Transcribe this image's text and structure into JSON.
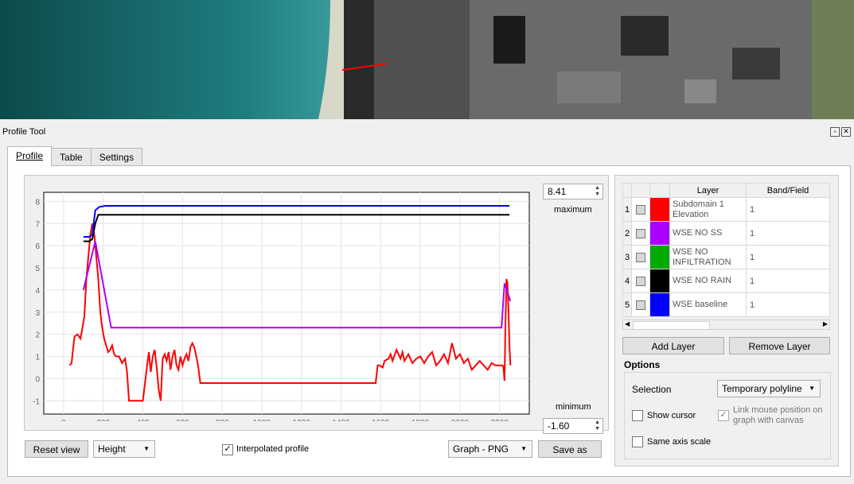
{
  "panel": {
    "title": "Profile Tool"
  },
  "tabs": [
    {
      "label": "Profile",
      "active": true
    },
    {
      "label": "Table",
      "active": false
    },
    {
      "label": "Settings",
      "active": false
    }
  ],
  "scale": {
    "maximum_value": "8.41",
    "maximum_label": "maximum",
    "minimum_value": "-1.60",
    "minimum_label": "minimum"
  },
  "bottom_bar": {
    "reset_view": "Reset view",
    "height_combo": "Height",
    "interpolated_label": "Interpolated profile",
    "interpolated_checked": true,
    "export_combo": "Graph - PNG",
    "save_as": "Save as"
  },
  "layers_table": {
    "headers": [
      "Layer",
      "Band/Field"
    ],
    "rows": [
      {
        "num": "1",
        "color": "#ff0000",
        "layer": "Subdomain 1 Elevation",
        "band": "1"
      },
      {
        "num": "2",
        "color": "#aa00ff",
        "layer": "WSE NO SS",
        "band": "1"
      },
      {
        "num": "3",
        "color": "#00aa00",
        "layer": "WSE NO INFILTRATION",
        "band": "1"
      },
      {
        "num": "4",
        "color": "#000000",
        "layer": "WSE NO RAIN",
        "band": "1"
      },
      {
        "num": "5",
        "color": "#0000ff",
        "layer": "WSE baseline",
        "band": "1"
      }
    ]
  },
  "layer_buttons": {
    "add": "Add Layer",
    "remove": "Remove Layer"
  },
  "options": {
    "title": "Options",
    "selection_label": "Selection",
    "selection_value": "Temporary polyline",
    "show_cursor": "Show cursor",
    "link_mouse": "Link mouse position on graph with canvas",
    "same_axis": "Same axis scale"
  },
  "chart_data": {
    "type": "line",
    "xlim": [
      -100,
      2350
    ],
    "ylim": [
      -1.6,
      8.41
    ],
    "x_ticks": [
      0,
      200,
      400,
      600,
      800,
      1000,
      1200,
      1400,
      1600,
      1800,
      2000,
      2200
    ],
    "y_ticks": [
      -1,
      0,
      1,
      2,
      3,
      4,
      5,
      6,
      7,
      8
    ],
    "grid": true,
    "series": [
      {
        "name": "Subdomain 1 Elevation",
        "color": "#ff0000",
        "x": [
          30,
          40,
          55,
          70,
          85,
          95,
          105,
          115,
          125,
          135,
          145,
          155,
          165,
          175,
          185,
          195,
          205,
          215,
          225,
          235,
          245,
          255,
          265,
          280,
          295,
          310,
          320,
          330,
          345,
          360,
          400,
          420,
          430,
          440,
          450,
          460,
          470,
          480,
          490,
          500,
          510,
          520,
          530,
          540,
          550,
          560,
          570,
          580,
          590,
          600,
          610,
          620,
          630,
          640,
          650,
          660,
          670,
          680,
          690,
          700,
          720,
          800,
          1000,
          1200,
          1400,
          1575,
          1585,
          1595,
          1610,
          1620,
          1640,
          1650,
          1660,
          1680,
          1700,
          1710,
          1720,
          1740,
          1760,
          1780,
          1800,
          1820,
          1840,
          1860,
          1880,
          1900,
          1920,
          1940,
          1960,
          1980,
          2000,
          2020,
          2040,
          2060,
          2080,
          2100,
          2120,
          2140,
          2160,
          2180,
          2200,
          2215,
          2220,
          2225,
          2230,
          2235,
          2240,
          2245,
          2250,
          2255
        ],
        "y": [
          0.6,
          0.7,
          1.9,
          2.0,
          1.8,
          2.3,
          2.8,
          4.5,
          5.5,
          6.5,
          7.0,
          6.5,
          5.5,
          4.5,
          3.0,
          2.3,
          1.8,
          1.5,
          1.2,
          1.3,
          1.5,
          1.1,
          1.0,
          1.0,
          0.7,
          0.9,
          0.3,
          -1.0,
          -1.0,
          -1.0,
          -1.0,
          0.5,
          1.2,
          0.3,
          1.0,
          1.3,
          0.5,
          -0.5,
          -1.0,
          0.9,
          1.1,
          0.8,
          1.2,
          0.4,
          1.0,
          1.3,
          0.6,
          0.4,
          1.0,
          0.6,
          0.9,
          1.1,
          0.8,
          1.4,
          1.6,
          1.4,
          1.0,
          0.5,
          -0.2,
          -0.2,
          -0.2,
          -0.2,
          -0.2,
          -0.2,
          -0.2,
          -0.2,
          0.6,
          0.6,
          0.5,
          0.8,
          0.9,
          1.1,
          0.8,
          1.3,
          0.9,
          1.2,
          0.8,
          1.1,
          0.7,
          0.9,
          1.0,
          0.7,
          1.0,
          1.2,
          0.6,
          0.8,
          1.1,
          0.7,
          1.6,
          0.9,
          1.1,
          0.7,
          0.9,
          0.4,
          0.6,
          0.8,
          0.6,
          0.4,
          0.7,
          0.6,
          0.6,
          0.6,
          0.5,
          -0.1,
          2.5,
          4.5,
          4.3,
          3.0,
          1.5,
          0.6
        ]
      },
      {
        "name": "WSE NO SS",
        "color": "#aa00ff",
        "x": [
          100,
          160,
          240,
          2210,
          2225,
          2255
        ],
        "y": [
          4.0,
          6.2,
          2.3,
          2.3,
          4.3,
          3.5
        ]
      },
      {
        "name": "WSE NO RAIN",
        "color": "#000000",
        "x": [
          100,
          130,
          145,
          160,
          175,
          2250
        ],
        "y": [
          6.2,
          6.2,
          6.3,
          7.0,
          7.4,
          7.4
        ]
      },
      {
        "name": "WSE baseline",
        "color": "#0000ff",
        "x": [
          100,
          130,
          145,
          160,
          180,
          210,
          2250
        ],
        "y": [
          6.4,
          6.4,
          6.5,
          7.6,
          7.75,
          7.8,
          7.8
        ]
      }
    ]
  }
}
